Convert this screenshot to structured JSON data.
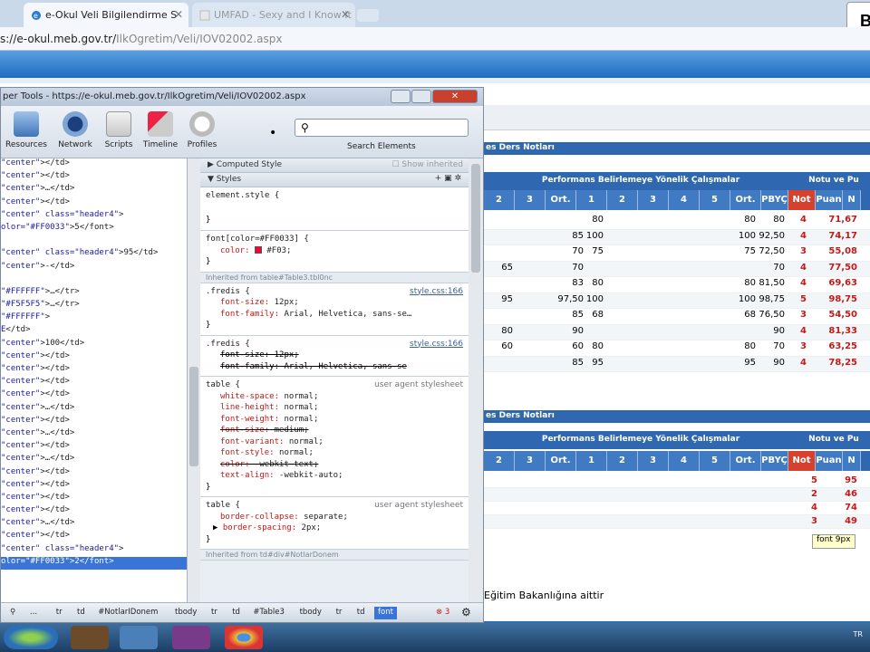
{
  "browser": {
    "tabs": [
      {
        "title": "e-Okul Veli Bilgilendirme S"
      },
      {
        "title": "UMFAD - Sexy and I Know It"
      }
    ],
    "url_host": "s://e-okul.meb.gov.tr/",
    "url_path": "IlkOgretim/Veli/IOV02002.aspx",
    "corner_badge": "B"
  },
  "page": {
    "section1_title": "es Ders Notları",
    "section2_title": "es Ders Notları",
    "perf_header": "Performans Belirlemeye Yönelik Çalışmalar",
    "notu_header": "Notu ve Pu",
    "num_headers_1": [
      "2",
      "3",
      "Ort.",
      "1",
      "2",
      "3",
      "4",
      "5",
      "Ort.",
      "PBYÇ Ort.",
      "Not",
      "Puan",
      "N"
    ],
    "num_headers_2": [
      "2",
      "3",
      "Ort.",
      "1",
      "2",
      "3",
      "4",
      "5",
      "Ort.",
      "PBYÇ Ort.",
      "Not",
      "Puan",
      "N"
    ],
    "rows1": [
      {
        "a": "",
        "b": "",
        "c": "",
        "d": "80",
        "e": "",
        "f": "80",
        "g": "80",
        "h": "4",
        "i": "71,67"
      },
      {
        "a": "",
        "b": "",
        "c": "85",
        "d": "100",
        "e": "",
        "f": "100",
        "g": "92,50",
        "h": "4",
        "i": "74,17"
      },
      {
        "a": "",
        "b": "",
        "c": "70",
        "d": "75",
        "e": "",
        "f": "75",
        "g": "72,50",
        "h": "3",
        "i": "55,08"
      },
      {
        "a": "65",
        "b": "",
        "c": "70",
        "d": "",
        "e": "",
        "f": "",
        "g": "70",
        "h": "4",
        "i": "77,50"
      },
      {
        "a": "",
        "b": "",
        "c": "83",
        "d": "80",
        "e": "",
        "f": "80",
        "g": "81,50",
        "h": "4",
        "i": "69,63"
      },
      {
        "a": "95",
        "b": "",
        "c": "97,50",
        "d": "100",
        "e": "",
        "f": "100",
        "g": "98,75",
        "h": "5",
        "i": "98,75"
      },
      {
        "a": "",
        "b": "",
        "c": "85",
        "d": "68",
        "e": "",
        "f": "68",
        "g": "76,50",
        "h": "3",
        "i": "54,50"
      },
      {
        "a": "80",
        "b": "",
        "c": "90",
        "d": "",
        "e": "",
        "f": "",
        "g": "90",
        "h": "4",
        "i": "81,33"
      },
      {
        "a": "60",
        "b": "",
        "c": "60",
        "d": "80",
        "e": "",
        "f": "80",
        "g": "70",
        "h": "3",
        "i": "63,25"
      },
      {
        "a": "",
        "b": "",
        "c": "85",
        "d": "95",
        "e": "",
        "f": "95",
        "g": "90",
        "h": "4",
        "i": "78,25"
      }
    ],
    "rows2": [
      {
        "not": "5",
        "puan": "95"
      },
      {
        "not": "2",
        "puan": "46"
      },
      {
        "not": "4",
        "puan": "74"
      },
      {
        "not": "3",
        "puan": "49"
      }
    ],
    "tooltip": "font 9px",
    "bottom_note": "Eğitim Bakanlığına aittir"
  },
  "devtools": {
    "title": "per Tools - https://e-okul.meb.gov.tr/IlkOgretim/Veli/IOV02002.aspx",
    "toolbar": [
      "Resources",
      "Network",
      "Scripts",
      "Timeline",
      "Profiles"
    ],
    "search_label": "Search Elements",
    "dom_lines": [
      [
        "\"center\"",
        "></td>"
      ],
      [
        "\"center\"",
        "></td>"
      ],
      [
        "\"center\"",
        ">…</td>"
      ],
      [
        "\"center\"",
        "></td>"
      ],
      [
        "\"center\" class=\"header4\"",
        ">"
      ],
      [
        "olor=\"#FF0033\"",
        ">5</font>"
      ],
      [
        "",
        ""
      ],
      [
        "\"center\" class=\"header4\"",
        ">95</td>"
      ],
      [
        "\"center\"",
        ">-</td>"
      ],
      [
        "",
        ""
      ],
      [
        "\"#FFFFFF\"",
        ">…</tr>"
      ],
      [
        "\"#F5F5F5\"",
        ">…</tr>"
      ],
      [
        "\"#FFFFFF\"",
        ">"
      ],
      [
        "E",
        "</td>"
      ],
      [
        "\"center\"",
        ">100</td>"
      ],
      [
        "\"center\"",
        "></td>"
      ],
      [
        "\"center\"",
        "></td>"
      ],
      [
        "\"center\"",
        "></td>"
      ],
      [
        "\"center\"",
        "></td>"
      ],
      [
        "\"center\"",
        ">…</td>"
      ],
      [
        "\"center\"",
        "></td>"
      ],
      [
        "\"center\"",
        ">…</td>"
      ],
      [
        "\"center\"",
        "></td>"
      ],
      [
        "\"center\"",
        ">…</td>"
      ],
      [
        "\"center\"",
        "></td>"
      ],
      [
        "\"center\"",
        "></td>"
      ],
      [
        "\"center\"",
        "></td>"
      ],
      [
        "\"center\"",
        "></td>"
      ],
      [
        "\"center\"",
        ">…</td>"
      ],
      [
        "\"center\"",
        "></td>"
      ],
      [
        "\"center\" class=\"header4\"",
        ">"
      ],
      [
        "olor=\"#FF0033\"",
        ">2</font>"
      ]
    ],
    "styles_header": "Styles",
    "computed_header": "Computed Style",
    "show_inherited": "Show inherited",
    "element_style": "element.style {",
    "font_rule_selector": "font[color=#FF0033] {",
    "font_rule_prop": "color:",
    "font_rule_value": "#F03;",
    "inherited1": "Inherited from table#Table3.tbl0nc",
    "fredis1_selector": ".fredis {",
    "fredis1_src": "style.css:166",
    "fredis1_p1n": "font-size:",
    "fredis1_p1v": "12px;",
    "fredis1_p2n": "font-family:",
    "fredis1_p2v": "Arial, Helvetica, sans-se…",
    "fredis2_selector": ".fredis {",
    "fredis2_src": "style.css:166",
    "fredis2_p1": "font-size: 12px;",
    "fredis2_p2": "font-family: Arial, Helvetica, sans-se",
    "table1_selector": "table {",
    "ua_label": "user agent stylesheet",
    "table1_props": [
      [
        "white-space:",
        "normal;",
        false
      ],
      [
        "line-height:",
        "normal;",
        false
      ],
      [
        "font-weight:",
        "normal;",
        false
      ],
      [
        "font-size:",
        "medium;",
        true
      ],
      [
        "font-variant:",
        "normal;",
        false
      ],
      [
        "font-style:",
        "normal;",
        false
      ],
      [
        "color:",
        "-webkit-text;",
        true
      ],
      [
        "text-align:",
        "-webkit-auto;",
        false
      ]
    ],
    "table2_selector": "table {",
    "table2_props": [
      [
        "border-collapse:",
        "separate;"
      ],
      [
        "border-spacing:",
        "2px;"
      ]
    ],
    "inherited2": "Inherited from td#div#NotlarDonem",
    "breadcrumbs": [
      "...",
      "tr",
      "td",
      "#NotlarIDonem",
      "tbody",
      "tr",
      "td",
      "#Table3",
      "tbody",
      "tr",
      "td",
      "font"
    ],
    "error_count": "3"
  },
  "taskbar": {
    "tray_text": "TR"
  },
  "colors": {
    "accent": "#2f67b1",
    "selected": "#3a74d6",
    "red": "#c41a1a"
  }
}
